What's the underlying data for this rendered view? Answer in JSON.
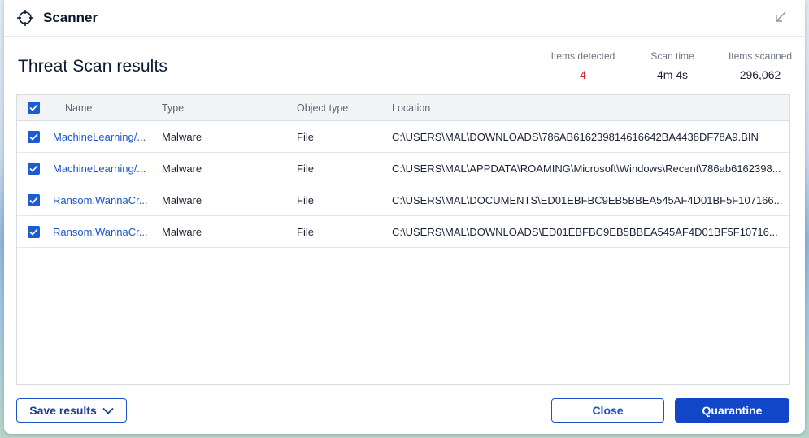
{
  "window": {
    "title": "Scanner"
  },
  "header": {
    "title": "Threat Scan results",
    "stats": {
      "items_detected_label": "Items detected",
      "items_detected_value": "4",
      "scan_time_label": "Scan time",
      "scan_time_value": "4m 4s",
      "items_scanned_label": "Items scanned",
      "items_scanned_value": "296,062"
    }
  },
  "table": {
    "columns": {
      "name": "Name",
      "type": "Type",
      "object_type": "Object type",
      "location": "Location"
    },
    "rows": [
      {
        "name": "MachineLearning/...",
        "type": "Malware",
        "object_type": "File",
        "location": "C:\\USERS\\MAL\\DOWNLOADS\\786AB616239814616642BA4438DF78A9.BIN"
      },
      {
        "name": "MachineLearning/...",
        "type": "Malware",
        "object_type": "File",
        "location": "C:\\USERS\\MAL\\APPDATA\\ROAMING\\Microsoft\\Windows\\Recent\\786ab6162398..."
      },
      {
        "name": "Ransom.WannaCr...",
        "type": "Malware",
        "object_type": "File",
        "location": "C:\\USERS\\MAL\\DOCUMENTS\\ED01EBFBC9EB5BBEA545AF4D01BF5F107166..."
      },
      {
        "name": "Ransom.WannaCr...",
        "type": "Malware",
        "object_type": "File",
        "location": "C:\\USERS\\MAL\\DOWNLOADS\\ED01EBFBC9EB5BBEA545AF4D01BF5F10716..."
      }
    ]
  },
  "footer": {
    "save_label": "Save results",
    "close_label": "Close",
    "quarantine_label": "Quarantine"
  },
  "icons": {
    "title": "crosshair-icon",
    "minimize": "arrow-down-left-icon",
    "save_dropdown": "chevron-down-icon",
    "checkbox": "checkmark-icon"
  },
  "colors": {
    "accent": "#1246c9",
    "link": "#1a55c9",
    "detected_count": "#d4202c"
  }
}
